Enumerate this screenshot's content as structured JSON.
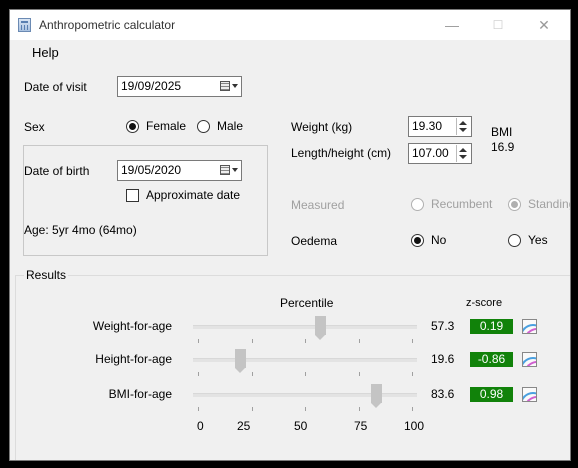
{
  "window": {
    "title": "Anthropometric calculator",
    "minimize": "—",
    "maximize": "☐",
    "close": "✕"
  },
  "menu": {
    "help": "Help"
  },
  "visit": {
    "label": "Date of visit",
    "value": "19/09/2025"
  },
  "sex": {
    "label": "Sex",
    "female": "Female",
    "male": "Male",
    "selected": "Female"
  },
  "dob": {
    "label": "Date of birth",
    "value": "19/05/2020",
    "approx_label": "Approximate date",
    "approx_checked": false
  },
  "age": {
    "text": "Age: 5yr 4mo (64mo)"
  },
  "weight": {
    "label": "Weight (kg)",
    "value": "19.30"
  },
  "height": {
    "label": "Length/height (cm)",
    "value": "107.00"
  },
  "bmi": {
    "label": "BMI",
    "value": "16.9"
  },
  "measured": {
    "label": "Measured",
    "recumbent": "Recumbent",
    "standing": "Standing",
    "selected": "Standing"
  },
  "oedema": {
    "label": "Oedema",
    "no": "No",
    "yes": "Yes",
    "selected": "No"
  },
  "results": {
    "legend": "Results",
    "percentile_header": "Percentile",
    "zscore_header": "z-score",
    "axis_ticks": [
      "0",
      "25",
      "50",
      "75",
      "100"
    ],
    "rows": [
      {
        "label": "Weight-for-age",
        "percentile": 57.3,
        "percentile_text": "57.3",
        "zscore": "0.19",
        "color": "#11820a"
      },
      {
        "label": "Height-for-age",
        "percentile": 19.6,
        "percentile_text": "19.6",
        "zscore": "-0.86",
        "color": "#11820a"
      },
      {
        "label": "BMI-for-age",
        "percentile": 83.6,
        "percentile_text": "83.6",
        "zscore": "0.98",
        "color": "#11820a"
      }
    ]
  },
  "icons": {
    "calendar": "calendar-dropdown-icon",
    "chart": "growth-chart-icon",
    "app": "calculator-app-icon"
  }
}
